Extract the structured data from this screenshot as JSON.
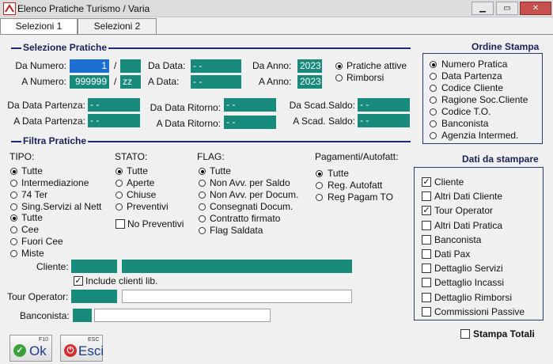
{
  "window": {
    "title": "Elenco Pratiche Turismo / Varia"
  },
  "tabs": [
    {
      "label": "Selezioni 1"
    },
    {
      "label": "Selezioni 2"
    }
  ],
  "selezione": {
    "header": "Selezione Pratiche",
    "da_numero_label": "Da Numero:",
    "da_numero_value": "1",
    "da_numero_suffix": "",
    "a_numero_label": "A Numero:",
    "a_numero_value": "999999",
    "a_numero_suffix": "zz",
    "slash": "/",
    "da_data_label": "Da Data:",
    "da_data_value": "- -",
    "a_data_label": "A Data:",
    "a_data_value": "- -",
    "da_anno_label": "Da Anno:",
    "da_anno_value": "2023",
    "a_anno_label": "A Anno:",
    "a_anno_value": "2023",
    "pratiche_attive": "Pratiche attive",
    "rimborsi": "Rimborsi",
    "da_data_partenza_label": "Da Data Partenza:",
    "da_data_partenza_value": "- -",
    "a_data_partenza_label": "A Data Partenza:",
    "a_data_partenza_value": "- -",
    "da_data_ritorno_label": "Da Data Ritorno:",
    "da_data_ritorno_value": "- -",
    "a_data_ritorno_label": "A Data Ritorno:",
    "a_data_ritorno_value": "- -",
    "da_scad_saldo_label": "Da Scad.Saldo:",
    "da_scad_saldo_value": "- -",
    "a_scad_saldo_label": "A Scad. Saldo:",
    "a_scad_saldo_value": "- -"
  },
  "filtra": {
    "header": "Filtra Pratiche",
    "tipo_label": "TIPO:",
    "tipo_options": [
      "Tutte",
      "Intermediazione",
      "74 Ter",
      "Sing.Servizi al Nett",
      "Tutte",
      "Cee",
      "Fuori Cee",
      "Miste"
    ],
    "stato_label": "STATO:",
    "stato_options": [
      "Tutte",
      "Aperte",
      "Chiuse",
      "Preventivi"
    ],
    "no_preventivi": "No Preventivi",
    "flag_label": "FLAG:",
    "flag_options": [
      "Tutte",
      "Non Avv. per Saldo",
      "Non Avv. per Docum.",
      "Consegnati Docum.",
      "Contratto firmato",
      "Flag Saldata"
    ],
    "pagamenti_label": "Pagamenti/Autofatt:",
    "pagamenti_options": [
      "Tutte",
      "Reg. Autofatt",
      "Reg Pagam TO"
    ],
    "cliente_label": "Cliente:",
    "include_clienti": "Include clienti lib.",
    "tour_operator_label": "Tour Operator:",
    "banconista_label": "Banconista:"
  },
  "ordine": {
    "header": "Ordine Stampa",
    "options": [
      "Numero Pratica",
      "Data Partenza",
      "Codice Cliente",
      "Ragione Soc.Cliente",
      "Codice T.O.",
      "Banconista",
      "Agenzia Intermed."
    ]
  },
  "dati": {
    "header": "Dati da stampare",
    "options": [
      "Cliente",
      "Altri Dati Cliente",
      "Tour Operator",
      "Altri Dati Pratica",
      "Banconista",
      "Dati Pax",
      "Dettaglio Servizi",
      "Dettaglio Incassi",
      "Dettaglio Rimborsi",
      "Commissioni Passive"
    ],
    "checked": [
      true,
      false,
      true,
      false,
      false,
      false,
      false,
      false,
      false,
      false
    ]
  },
  "stampa_totali": "Stampa Totali",
  "buttons": {
    "ok_label": "Ok",
    "ok_hotkey": "F10",
    "esci_label": "Esci",
    "esci_hotkey": "ESC"
  },
  "colors": {
    "field": "#178a7c",
    "selected_field": "#1e6fd2",
    "section_line": "#1f2a78"
  }
}
